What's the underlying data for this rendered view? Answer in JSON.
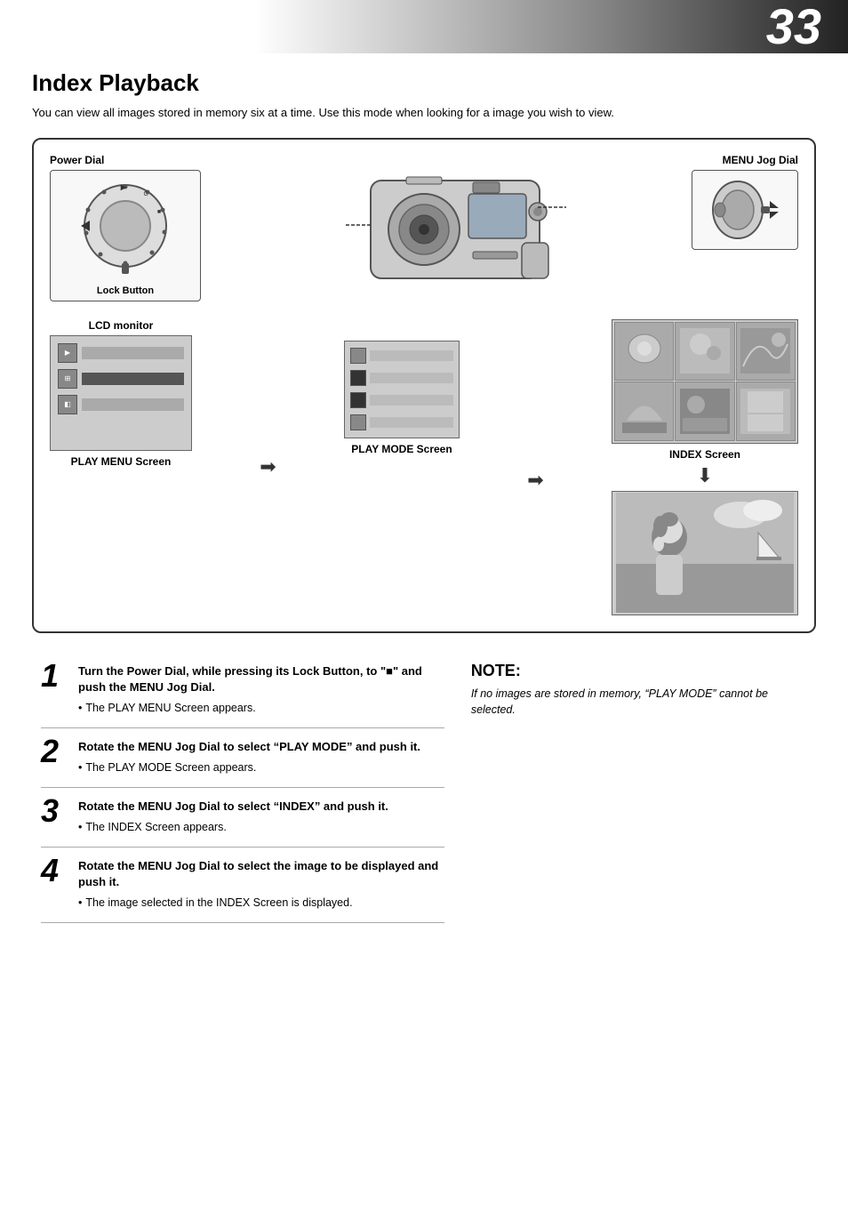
{
  "page": {
    "number": "33",
    "title": "Index Playback",
    "intro": "You can view all images stored in memory six at a time. Use this mode when looking for a image you wish to view."
  },
  "diagram": {
    "power_dial_label": "Power Dial",
    "lock_button_label": "Lock Button",
    "menu_jog_dial_label": "MENU Jog Dial",
    "lcd_monitor_label": "LCD monitor",
    "play_menu_screen_label": "PLAY MENU Screen",
    "play_mode_screen_label": "PLAY MODE Screen",
    "index_screen_label": "INDEX Screen"
  },
  "steps": [
    {
      "number": "1",
      "main": "Turn the Power Dial, while pressing its Lock Button, to \"■\" and push the MENU Jog Dial.",
      "bullet": "The PLAY MENU Screen appears."
    },
    {
      "number": "2",
      "main": "Rotate the MENU Jog Dial to select “PLAY MODE” and push it.",
      "bullet": "The PLAY MODE Screen appears."
    },
    {
      "number": "3",
      "main": "Rotate the MENU Jog Dial to select “INDEX” and push it.",
      "bullet": "The INDEX Screen appears."
    },
    {
      "number": "4",
      "main": "Rotate the MENU Jog Dial to select the image to be displayed and push it.",
      "bullet": "The image selected in the INDEX Screen is displayed."
    }
  ],
  "note": {
    "title": "NOTE:",
    "text": "If no images are stored in memory, “PLAY MODE” cannot be selected."
  }
}
